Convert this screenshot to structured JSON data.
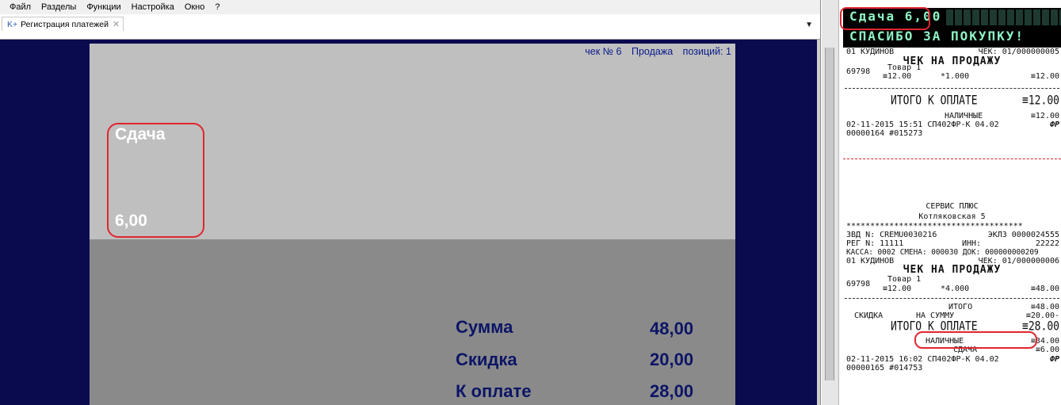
{
  "menu": [
    "Файл",
    "Разделы",
    "Функции",
    "Настройка",
    "Окно",
    "?"
  ],
  "tab": {
    "prefix": "K+",
    "label": "Регистрация платежей",
    "close": "✕",
    "dropdown": "▼"
  },
  "check": {
    "number": "чек № 6",
    "operation": "Продажа",
    "positions": "позиций: 1",
    "change_label": "Сдача",
    "change_value": "6,00",
    "totals": [
      {
        "label": "Сумма",
        "value": "48,00"
      },
      {
        "label": "Скидка",
        "value": "20,00"
      },
      {
        "label": "К оплате",
        "value": "28,00"
      }
    ]
  },
  "customer_display": {
    "line1": "Сдача 6,00",
    "line2": "СПАСИБО ЗА ПОКУПКУ!"
  },
  "receipt1": {
    "cashier": "01 КУДИНОВ",
    "check_no": "ЧЕК: 01/000000005",
    "title": "ЧЕК НА ПРОДАЖУ",
    "item_code": "69798",
    "item_name": "Товар 1",
    "item_price": "≡12.00",
    "item_qty": "*1.000",
    "item_sum": "≡12.00",
    "total_label": "ИТОГО К ОПЛАТЕ",
    "total_value": "≡12.00",
    "payment_label": "НАЛИЧНЫЕ",
    "payment_value": "≡12.00",
    "datetime": "02-11-2015 15:51 СП402ФР-К 04.02",
    "logo": "ФР",
    "doc": "00000164 #015273"
  },
  "receipt2": {
    "org": "СЕРВИС ПЛЮС",
    "address": "Котляковская 5",
    "stars": "*************************************",
    "zvd": "ЗВД N: CREMU0030216",
    "eklz": "ЭКЛЗ 0000024555",
    "reg": "РЕГ N: 11111",
    "inn_label": "ИНН:",
    "inn": "22222",
    "kassa": "КАССА: 0002 СМЕНА: 000030 ДОК: 000000000209",
    "cashier": "01 КУДИНОВ",
    "check_no": "ЧЕК: 01/000000006",
    "title": "ЧЕК НА ПРОДАЖУ",
    "item_code": "69798",
    "item_name": "Товар 1",
    "item_price": "≡12.00",
    "item_qty": "*4.000",
    "item_sum": "≡48.00",
    "subtotal_label": "ИТОГО",
    "subtotal_value": "≡48.00",
    "discount_label": "СКИДКА",
    "discount_mid": "НА СУММУ",
    "discount_value": "≡20.00-",
    "total_label": "ИТОГО К ОПЛАТЕ",
    "total_value": "≡28.00",
    "payment_label": "НАЛИЧНЫЕ",
    "payment_value": "≡34.00",
    "change_label": "СДАЧА",
    "change_value": "≡6.00",
    "datetime": "02-11-2015 16:02 СП402ФР-К 04.02",
    "logo": "ФР",
    "doc": "00000165 #014753"
  }
}
